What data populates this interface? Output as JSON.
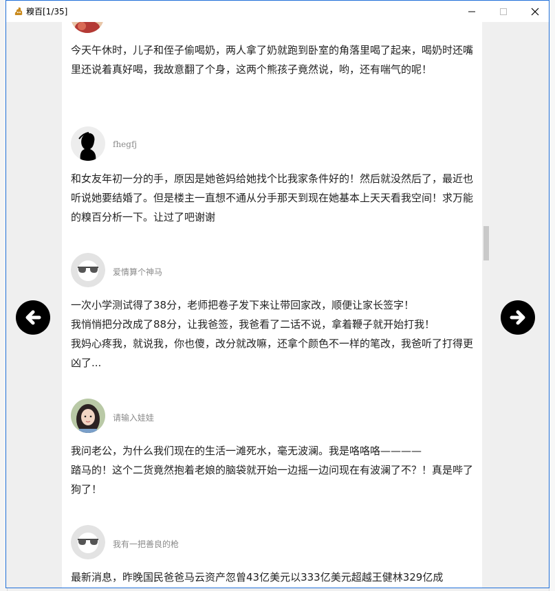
{
  "window": {
    "title": "糗百[1/35]"
  },
  "nav": {
    "prev_icon": "arrow-left-icon",
    "next_icon": "arrow-right-icon"
  },
  "posts": [
    {
      "author": "",
      "avatar": "photo-avatar-partial",
      "text": "今天午休时，儿子和侄子偷喝奶，两人拿了奶就跑到卧室的角落里喝了起来，喝奶时还嘴里还说着真好喝，我故意翻了个身，这两个熊孩子竟然说，哟，还有喘气的呢！"
    },
    {
      "author": "fhegfj",
      "avatar": "silhouette-avatar",
      "text": "和女友年初一分的手，原因是她爸妈给她找个比我家条件好的！然后就没然后了，最近也听说她要结婚了。但是楼主一直想不通从分手那天到现在她基本上天天看我空间！求万能的糗百分析一下。让过了吧谢谢"
    },
    {
      "author": "爱情算个神马",
      "avatar": "default-sunglasses-avatar",
      "text": "一次小学测试得了38分，老师把卷子发下来让带回家改，顺便让家长签字！\n我悄悄把分改成了88分，让我爸签，我爸看了二话不说，拿着鞭子就开始打我！\n我妈心疼我，就说我，你也傻，改分就改嘛，还拿个颜色不一样的笔改，我爸听了打得更凶了..."
    },
    {
      "author": "请输入娃娃",
      "avatar": "photo-avatar-girl",
      "text": "我问老公，为什么我们现在的生活一滩死水，毫无波澜。我是咯咯咯————\n踏马的！这个二货竟然抱着老娘的脑袋就开始一边摇一边问现在有波澜了不？！真是哔了狗了！"
    },
    {
      "author": "我有一把善良的枪",
      "avatar": "default-sunglasses-avatar",
      "text": "最新消息，昨晚国民爸爸马云资产忽曾43亿美元以333亿美元超越王健林329亿成"
    }
  ],
  "colors": {
    "window_border": "#1e6fd9",
    "panel_bg": "#ffffff",
    "outer_bg": "#efefef",
    "author_name": "#8a8a8a",
    "text": "#222222"
  }
}
